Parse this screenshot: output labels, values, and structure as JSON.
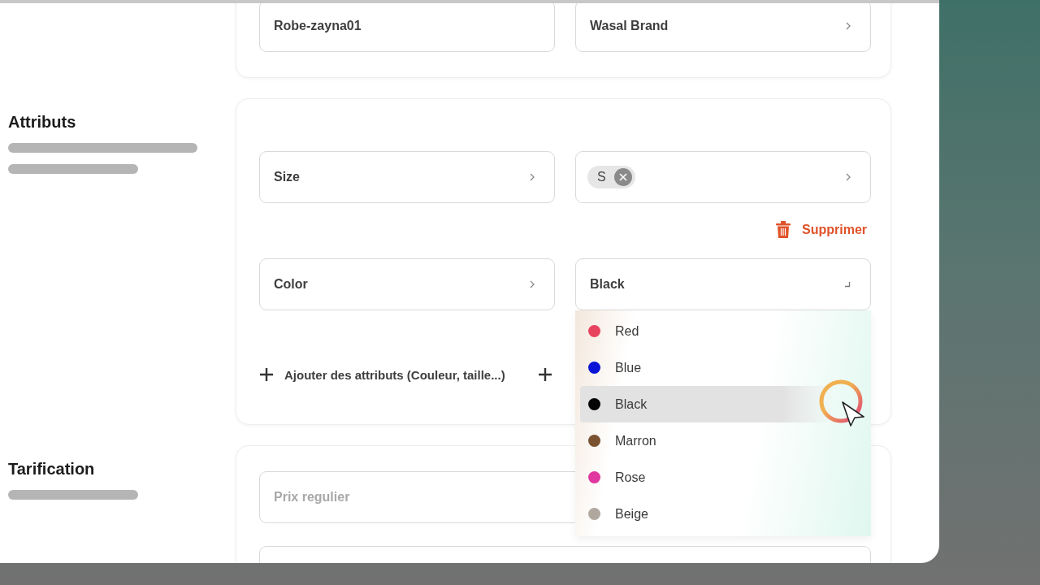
{
  "product_fields": {
    "reference": "Robe-zayna01",
    "brand": "Wasal Brand"
  },
  "attributes": {
    "title": "Attributs",
    "rows": [
      {
        "kind": "chips",
        "name": "Size",
        "values": [
          {
            "label": "S"
          }
        ]
      },
      {
        "kind": "select",
        "name": "Color",
        "value": "Black",
        "expanded": true,
        "options": [
          {
            "label": "Red",
            "color": "#e8435e",
            "selected": false
          },
          {
            "label": "Blue",
            "color": "#0a14d8",
            "selected": false
          },
          {
            "label": "Black",
            "color": "#050505",
            "selected": true
          },
          {
            "label": "Marron",
            "color": "#7a5230",
            "selected": false
          },
          {
            "label": "Rose",
            "color": "#e0389e",
            "selected": false
          },
          {
            "label": "Beige",
            "color": "#b0a89e",
            "selected": false
          }
        ]
      }
    ],
    "delete_label": "Supprimer",
    "add_label": "Ajouter des attributs (Couleur, taille...)"
  },
  "pricing": {
    "title": "Tarification",
    "regular_price": {
      "placeholder": "Prix regulier"
    }
  }
}
